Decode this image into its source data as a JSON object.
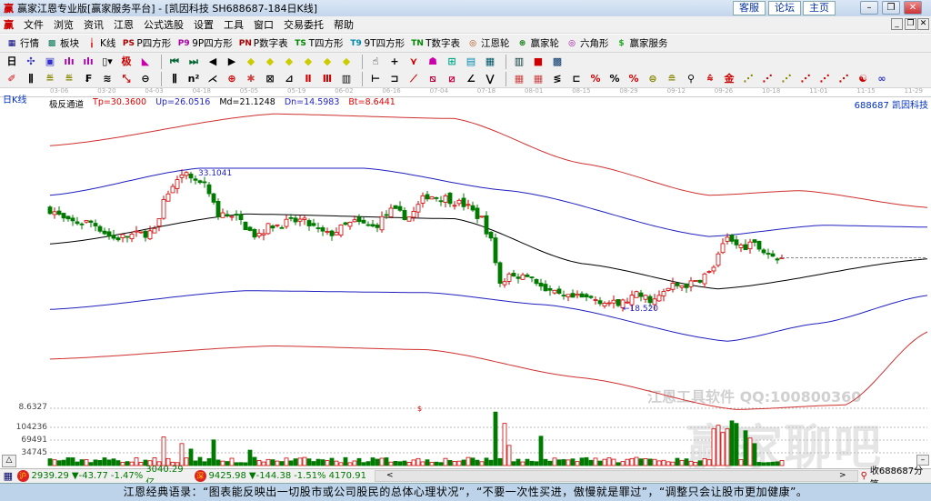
{
  "window": {
    "title": "赢家江恩专业版[赢家服务平台] - [凯因科技  SH688687-184日K线]",
    "links": [
      "客服",
      "论坛",
      "主页"
    ],
    "logo": "赢"
  },
  "menu": [
    "文件",
    "浏览",
    "资讯",
    "江恩",
    "公式选股",
    "设置",
    "工具",
    "窗口",
    "交易委托",
    "帮助"
  ],
  "toolbar1": [
    {
      "icon": "grid-icon",
      "glyph": "▦",
      "color": "#000080",
      "label": "行情"
    },
    {
      "icon": "blocks-icon",
      "glyph": "▩",
      "color": "#0a7a5a",
      "label": "板块"
    },
    {
      "icon": "kline-icon",
      "glyph": "╽",
      "color": "#c00",
      "label": "K线"
    },
    {
      "icon": "ps-icon",
      "glyph": "PS",
      "color": "#a00",
      "label": "P四方形"
    },
    {
      "icon": "p9-icon",
      "glyph": "P9",
      "color": "#a0a",
      "label": "9P四方形"
    },
    {
      "icon": "pn-icon",
      "glyph": "PN",
      "color": "#a00",
      "label": "P数字表"
    },
    {
      "icon": "ts-icon",
      "glyph": "TS",
      "color": "#080",
      "label": "T四方形"
    },
    {
      "icon": "t9-icon",
      "glyph": "T9",
      "color": "#08a",
      "label": "9T四方形"
    },
    {
      "icon": "tn-icon",
      "glyph": "TN",
      "color": "#080",
      "label": "T数字表"
    },
    {
      "icon": "target-icon",
      "glyph": "◎",
      "color": "#a40",
      "label": "江恩轮"
    },
    {
      "icon": "wheel-icon",
      "glyph": "⊛",
      "color": "#070",
      "label": "赢家轮"
    },
    {
      "icon": "hexagon-icon",
      "glyph": "◎",
      "color": "#909",
      "label": "六角形"
    },
    {
      "icon": "dollar-icon",
      "glyph": "$",
      "color": "#2a2",
      "label": "赢家服务"
    }
  ],
  "toolbar2": [
    {
      "icon": "period-dropdown-icon",
      "glyph": "日▾",
      "color": "#000"
    },
    {
      "icon": "chart-type-icon",
      "glyph": "✣",
      "color": "#33c"
    },
    {
      "icon": "info-icon",
      "glyph": "▣",
      "color": "#33c"
    },
    {
      "icon": "bars-icon",
      "glyph": "ılı",
      "color": "#a0a"
    },
    {
      "icon": "bars2-icon",
      "glyph": "ılı",
      "color": "#a0a"
    },
    {
      "icon": "candle-dropdown-icon",
      "glyph": "▯▾",
      "color": "#000"
    },
    {
      "icon": "indicator-icon",
      "glyph": "极",
      "color": "#c00"
    },
    {
      "icon": "flag-icon",
      "glyph": "◣",
      "color": "#c0a"
    },
    {
      "icon": "first-icon",
      "glyph": "⏮",
      "color": "#063"
    },
    {
      "icon": "last-icon",
      "glyph": "⏭",
      "color": "#063"
    },
    {
      "icon": "prev-icon",
      "glyph": "◀",
      "color": "#000"
    },
    {
      "icon": "next-icon",
      "glyph": "▶",
      "color": "#000"
    },
    {
      "icon": "move-up-icon",
      "glyph": "◆",
      "color": "#cc0"
    },
    {
      "icon": "move-down-icon",
      "glyph": "◆",
      "color": "#cc0"
    },
    {
      "icon": "zoom-in-icon",
      "glyph": "◆",
      "color": "#cc0"
    },
    {
      "icon": "zoom-out-icon",
      "glyph": "◆",
      "color": "#cc0"
    },
    {
      "icon": "expand-icon",
      "glyph": "◆",
      "color": "#cc0"
    },
    {
      "icon": "shrink-icon",
      "glyph": "◆",
      "color": "#cc0"
    },
    {
      "icon": "hand-icon",
      "glyph": "☝",
      "color": "#000"
    },
    {
      "icon": "crosshair-icon",
      "glyph": "+",
      "color": "#000"
    },
    {
      "icon": "line-icon",
      "glyph": "⋎",
      "color": "#c00"
    },
    {
      "icon": "tool-icon",
      "glyph": "☗",
      "color": "#c0a"
    },
    {
      "icon": "calc-icon",
      "glyph": "⊞",
      "color": "#0a8"
    },
    {
      "icon": "calendar-icon",
      "glyph": "▤",
      "color": "#08a"
    },
    {
      "icon": "calculator-icon",
      "glyph": "▦",
      "color": "#056"
    },
    {
      "icon": "report-icon",
      "glyph": "▥",
      "color": "#033"
    },
    {
      "icon": "save-icon",
      "glyph": "■",
      "color": "#c00"
    },
    {
      "icon": "print-icon",
      "glyph": "▩",
      "color": "#036"
    }
  ],
  "toolbar3": [
    {
      "icon": "pen-icon",
      "glyph": "✐",
      "color": "#c00"
    },
    {
      "icon": "parallel-icon",
      "glyph": "⫼",
      "color": "#000"
    },
    {
      "icon": "fib-icon",
      "glyph": "≝",
      "color": "#880"
    },
    {
      "icon": "fib2-icon",
      "glyph": "≝",
      "color": "#880"
    },
    {
      "icon": "f-icon",
      "glyph": "₣",
      "color": "#000"
    },
    {
      "icon": "wave-icon",
      "glyph": "≋",
      "color": "#000"
    },
    {
      "icon": "line-tool-icon",
      "glyph": "⤡",
      "color": "#c00"
    },
    {
      "icon": "circle-icon",
      "glyph": "⊖",
      "color": "#000"
    },
    {
      "icon": "cycle-icon",
      "glyph": "⫼",
      "color": "#000"
    },
    {
      "icon": "n2-icon",
      "glyph": "n²",
      "color": "#000"
    },
    {
      "icon": "fan-icon",
      "glyph": "⋌",
      "color": "#000"
    },
    {
      "icon": "gann-icon",
      "glyph": "⊕",
      "color": "#c00"
    },
    {
      "icon": "star-icon",
      "glyph": "✱",
      "color": "#c44"
    },
    {
      "icon": "box-icon",
      "glyph": "⊠",
      "color": "#000"
    },
    {
      "icon": "angle-icon",
      "glyph": "⊿",
      "color": "#000"
    },
    {
      "icon": "tool-a-icon",
      "glyph": "Ⅱ",
      "color": "#c00"
    },
    {
      "icon": "tool-b-icon",
      "glyph": "Ⅲ",
      "color": "#c00"
    },
    {
      "icon": "tool-c-icon",
      "glyph": "▥",
      "color": "#000"
    },
    {
      "icon": "tool-d-icon",
      "glyph": "⊢",
      "color": "#000"
    },
    {
      "icon": "rect-icon",
      "glyph": "⊐",
      "color": "#000"
    },
    {
      "icon": "ray-icon",
      "glyph": "⟋",
      "color": "#c00"
    },
    {
      "icon": "square-icon",
      "glyph": "⧅",
      "color": "#c04"
    },
    {
      "icon": "diag-icon",
      "glyph": "⧄",
      "color": "#c04"
    },
    {
      "icon": "angle2-icon",
      "glyph": "∠",
      "color": "#000"
    },
    {
      "icon": "v-icon",
      "glyph": "⋁",
      "color": "#000"
    },
    {
      "icon": "grid2-icon",
      "glyph": "▦",
      "color": "#c44"
    },
    {
      "icon": "grid3-icon",
      "glyph": "▦",
      "color": "#c44"
    },
    {
      "icon": "lines-icon",
      "glyph": "≶",
      "color": "#000"
    },
    {
      "icon": "frame-icon",
      "glyph": "⊏",
      "color": "#000"
    },
    {
      "icon": "percent-icon",
      "glyph": "%",
      "color": "#c00"
    },
    {
      "icon": "pct-icon",
      "glyph": "%",
      "color": "#000"
    },
    {
      "icon": "pct2-icon",
      "glyph": "%",
      "color": "#c00"
    },
    {
      "icon": "coin-icon",
      "glyph": "⊜",
      "color": "#880"
    },
    {
      "icon": "coin2-icon",
      "glyph": "≘",
      "color": "#880"
    },
    {
      "icon": "pin-icon",
      "glyph": "⚲",
      "color": "#000"
    },
    {
      "icon": "rise-icon",
      "glyph": "⩯",
      "color": "#c00"
    },
    {
      "icon": "gold-icon",
      "glyph": "金",
      "color": "#c00"
    },
    {
      "icon": "slope-icon",
      "glyph": "⋰",
      "color": "#880"
    },
    {
      "icon": "slope2-icon",
      "glyph": "⋰",
      "color": "#c00"
    },
    {
      "icon": "slope3-icon",
      "glyph": "⋰",
      "color": "#880"
    },
    {
      "icon": "slope4-icon",
      "glyph": "⋰",
      "color": "#c00"
    },
    {
      "icon": "slope5-icon",
      "glyph": "⋰",
      "color": "#c00"
    },
    {
      "icon": "slope6-icon",
      "glyph": "⋰",
      "color": "#c00"
    },
    {
      "icon": "yin-yang-icon",
      "glyph": "☯",
      "color": "#c00"
    },
    {
      "icon": "infinity-icon",
      "glyph": "∞",
      "color": "#33c"
    }
  ],
  "date_ticks": [
    "03-06",
    "03-20",
    "04-03",
    "04-18",
    "05-05",
    "05-19",
    "06-02",
    "06-16",
    "07-04",
    "07-18",
    "08-01",
    "08-15",
    "08-29",
    "09-12",
    "09-26",
    "10-18",
    "11-01",
    "11-15",
    "11-29"
  ],
  "period_label": "日K线",
  "indicator": {
    "name": "极反通道",
    "tp": "Tp=30.3600",
    "up": "Up=26.0516",
    "md": "Md=21.1248",
    "dn": "Dn=14.5983",
    "bt": "Bt=8.6441"
  },
  "stock": "688687  凯因科技",
  "colors": {
    "up": "#d00000",
    "down": "#007a00",
    "band_outer": "#d03030",
    "band_inner": "#2020c0",
    "mid": "#000000"
  },
  "annotations": {
    "high": "33.1041",
    "low": "←18.520",
    "dollar": "$"
  },
  "sub_axis": {
    "indicator_value": "8.6327",
    "volume_ticks": [
      "104236",
      "69491",
      "34745"
    ]
  },
  "chart_data": {
    "type": "candlestick",
    "close_keypoints": [
      [
        0,
        29.0
      ],
      [
        4,
        27.6
      ],
      [
        9,
        27.6
      ],
      [
        14,
        25.9
      ],
      [
        19,
        26.3
      ],
      [
        23,
        26.6
      ],
      [
        26,
        30.9
      ],
      [
        30,
        32.7
      ],
      [
        34,
        31.4
      ],
      [
        37,
        28.5
      ],
      [
        41,
        28.0
      ],
      [
        45,
        26.3
      ],
      [
        49,
        27.3
      ],
      [
        55,
        27.8
      ],
      [
        61,
        26.3
      ],
      [
        67,
        27.6
      ],
      [
        71,
        27.1
      ],
      [
        75,
        28.8
      ],
      [
        79,
        28.2
      ],
      [
        83,
        30.5
      ],
      [
        87,
        30.2
      ],
      [
        91,
        29.5
      ],
      [
        95,
        28.0
      ],
      [
        97,
        25.6
      ],
      [
        99,
        21.2
      ],
      [
        101,
        21.7
      ],
      [
        105,
        22.2
      ],
      [
        109,
        20.3
      ],
      [
        113,
        19.5
      ],
      [
        119,
        19.5
      ],
      [
        125,
        18.8
      ],
      [
        129,
        19.8
      ],
      [
        133,
        19.3
      ],
      [
        137,
        20.8
      ],
      [
        141,
        21.0
      ],
      [
        145,
        22.2
      ],
      [
        149,
        25.6
      ],
      [
        152,
        25.1
      ],
      [
        155,
        25.1
      ],
      [
        158,
        24.3
      ],
      [
        161,
        23.4
      ]
    ],
    "bands": {
      "tp": [
        [
          0,
          35.8
        ],
        [
          49,
          39.2
        ],
        [
          89,
          38.7
        ],
        [
          117,
          33.9
        ],
        [
          145,
          30.5
        ],
        [
          165,
          31.0
        ],
        [
          193,
          29.2
        ]
      ],
      "up": [
        [
          0,
          30.5
        ],
        [
          33,
          33.4
        ],
        [
          69,
          33.4
        ],
        [
          101,
          31.0
        ],
        [
          145,
          26.1
        ],
        [
          170,
          27.3
        ],
        [
          193,
          27.1
        ]
      ],
      "md": [
        [
          0,
          25.3
        ],
        [
          43,
          28.5
        ],
        [
          89,
          28.0
        ],
        [
          117,
          23.2
        ],
        [
          147,
          20.5
        ],
        [
          193,
          23.7
        ]
      ],
      "dn": [
        [
          0,
          18.3
        ],
        [
          43,
          20.3
        ],
        [
          83,
          20.1
        ],
        [
          109,
          18.8
        ],
        [
          149,
          14.9
        ],
        [
          169,
          16.8
        ],
        [
          193,
          19.8
        ]
      ],
      "bt": [
        [
          0,
          13.0
        ],
        [
          49,
          14.4
        ],
        [
          83,
          14.0
        ],
        [
          117,
          11.0
        ],
        [
          151,
          7.6
        ],
        [
          175,
          8.1
        ],
        [
          193,
          15.9
        ]
      ]
    },
    "volume_spikes": [
      [
        25,
        78000
      ],
      [
        29,
        60000
      ],
      [
        31,
        45000
      ],
      [
        36,
        70000
      ],
      [
        44,
        42000
      ],
      [
        98,
        146000
      ],
      [
        100,
        115000
      ],
      [
        101,
        55000
      ],
      [
        108,
        80000
      ],
      [
        146,
        100000
      ],
      [
        147,
        110000
      ],
      [
        148,
        90000
      ],
      [
        149,
        100000
      ],
      [
        150,
        122000
      ],
      [
        151,
        115000
      ],
      [
        153,
        95000
      ],
      [
        154,
        75000
      ],
      [
        155,
        60000
      ]
    ],
    "volume_base": 15000
  },
  "status": {
    "sh_value": "2939.29",
    "sh_change": "▼-43.77",
    "sh_pct": "-1.47%",
    "sh_amount": "3040.29亿",
    "sz_value": "9425.98",
    "sz_change": "▼-144.38",
    "sz_pct": "-1.51%",
    "sz_amount": "4170.91",
    "sh_badge": "沪",
    "sz_badge": "深",
    "receiving": "收688687分笔"
  },
  "watermark": {
    "line1": "江恩工具软件  QQ:100800360",
    "line2": "赢家聊吧"
  },
  "quote": "江恩经典语录：“图表能反映出一切股市或公司股民的总体心理状况”，“不要一次性买进，傲慢就是罪过”，“调整只会让股市更加健康”。"
}
